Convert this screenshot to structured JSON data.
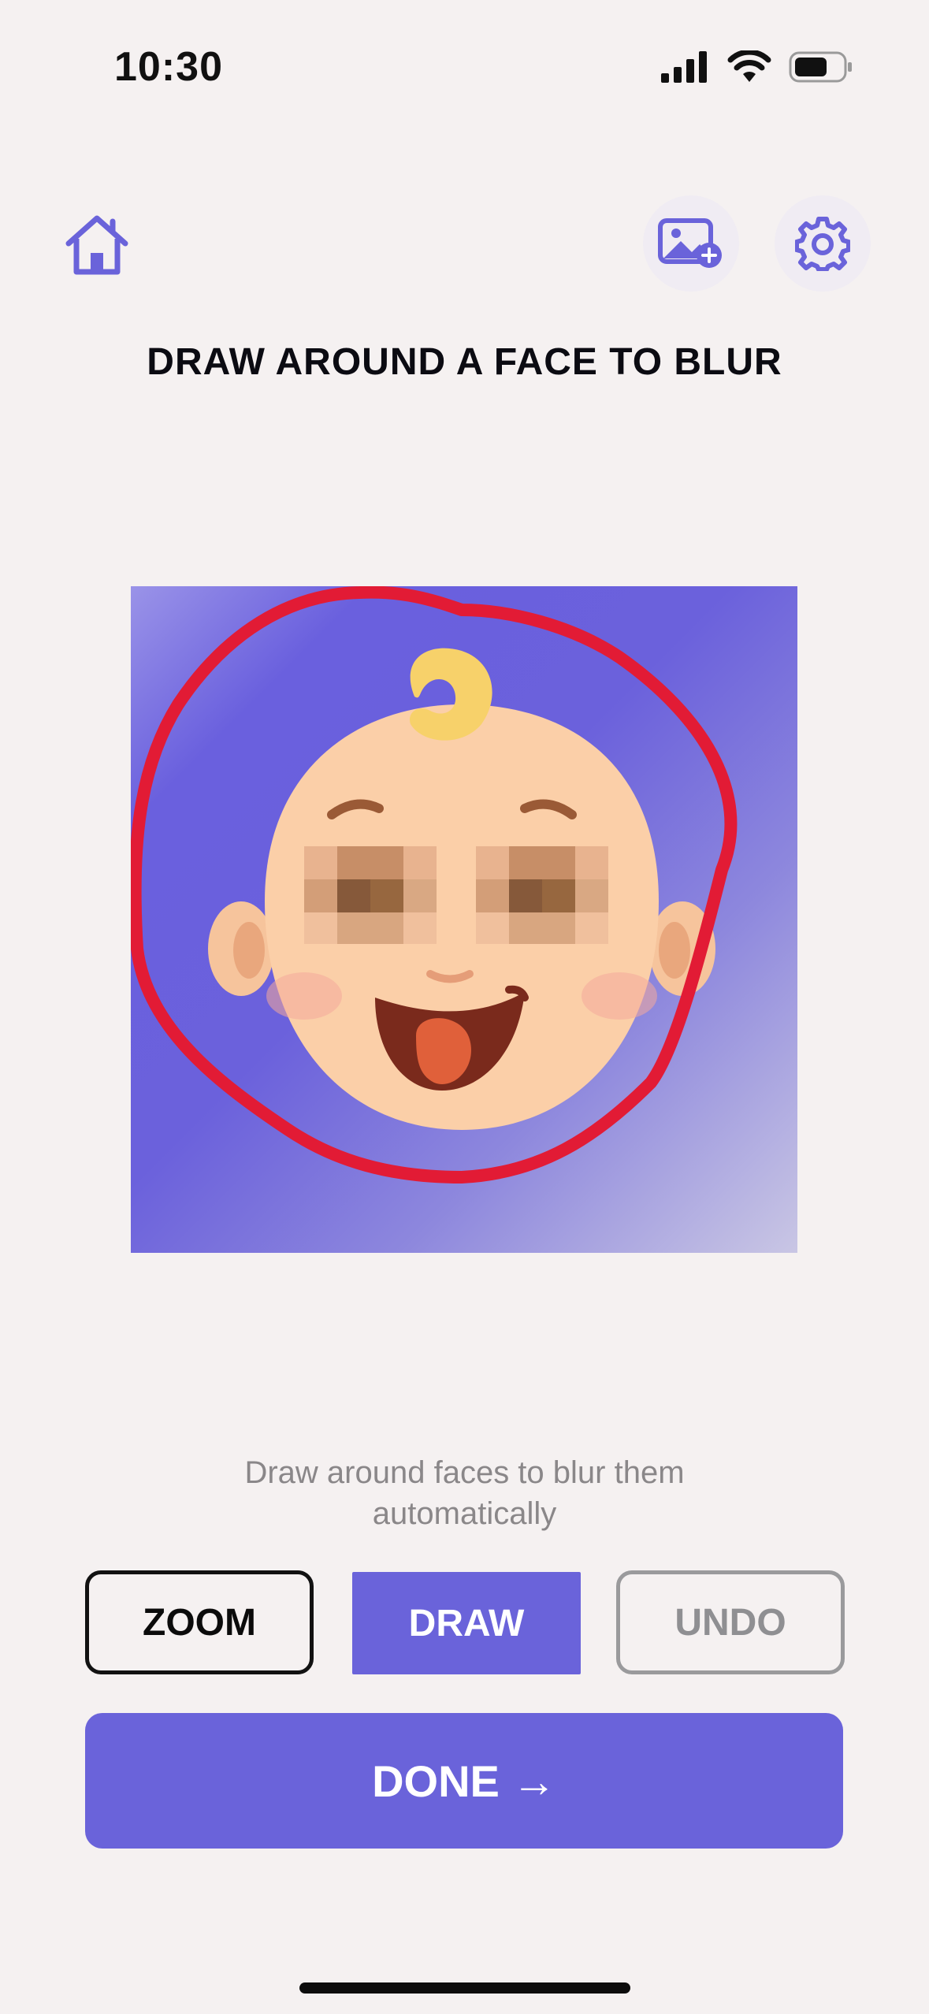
{
  "status_bar": {
    "time": "10:30"
  },
  "header": {
    "home_icon": "home-icon",
    "add_photo_icon": "image-add-icon",
    "settings_icon": "gear-icon"
  },
  "title": "DRAW AROUND A FACE TO BLUR",
  "hint": {
    "line1": "Draw around faces to blur them",
    "line2": "automatically"
  },
  "tools": {
    "zoom": "ZOOM",
    "draw": "DRAW",
    "undo": "UNDO"
  },
  "done": {
    "label": "DONE",
    "arrow": "→"
  },
  "colors": {
    "accent": "#6a63da",
    "stroke": "#e21b35",
    "background": "#f5f1f1"
  }
}
